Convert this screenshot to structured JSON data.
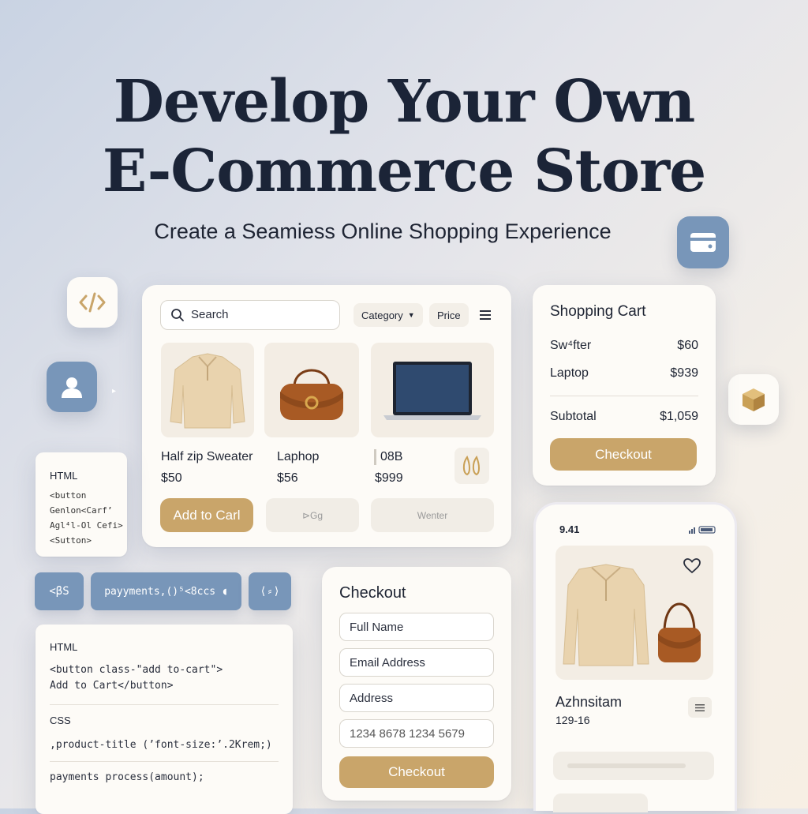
{
  "hero": {
    "title_line1": "Develop Your Own",
    "title_line2": "E-Commerce Store",
    "subtitle": "Create a Seamiess Online Shopping Experience"
  },
  "catalog": {
    "search_placeholder": "Search",
    "category_label": "Category",
    "price_label": "Price",
    "products": [
      {
        "name": "Half zip Sweater",
        "price": "$50"
      },
      {
        "name": "Laphop",
        "price": "$56"
      },
      {
        "name": "08B",
        "price": "$999"
      }
    ],
    "add_to_cart_label": "Add to Carl",
    "ghost_button_2": "⊳Gg",
    "ghost_button_3": "Wenter"
  },
  "cart": {
    "title": "Shopping Cart",
    "items": [
      {
        "name": "Sw⁴fter",
        "price": "$60"
      },
      {
        "name": "Laptop",
        "price": "$939"
      }
    ],
    "subtotal_label": "Subtotal",
    "subtotal_value": "$1,059",
    "checkout_label": "Checkout"
  },
  "code_small": {
    "heading": "HTML",
    "lines": [
      "<button",
      "Genlon<Carf’",
      "Agl⁴l-Ol Cefi>",
      "<Sutton>"
    ]
  },
  "pills": {
    "pill1": "<βS",
    "pill2": "payyments,()⁵<8ccs ◖",
    "pill3": "⟨⸗⟩"
  },
  "code_large": {
    "html_heading": "HTML",
    "html_line1": "<button class-\"add to-cart\">",
    "html_line2": "Add to Cart</button>",
    "css_heading": "CSS",
    "css_line": ",product-title (’font-size:’.2Krem;)",
    "js_line": "payments process(amount);"
  },
  "checkout": {
    "title": "Checkout",
    "full_name": "Full Name",
    "email": "Email Address",
    "address": "Address",
    "card_number": "1234 8678 1234 5679",
    "button_label": "Checkout"
  },
  "phone": {
    "time": "9.41",
    "product_name": "Azhnsitam",
    "product_sub": "129-16"
  },
  "colors": {
    "accent_gold": "#c9a56a",
    "accent_blue": "#7896b9",
    "navy_text": "#1b2437"
  },
  "icons": [
    "code-icon",
    "user-icon",
    "credit-card-icon",
    "box-icon",
    "search-icon",
    "menu-icon",
    "heart-icon",
    "earrings-icon"
  ]
}
